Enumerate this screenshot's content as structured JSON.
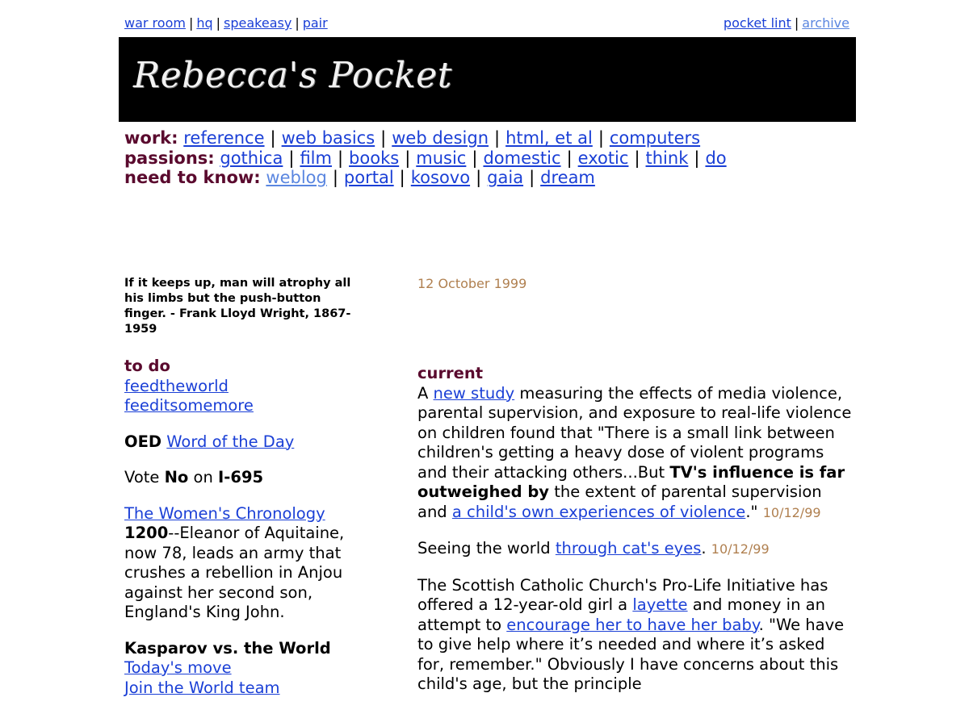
{
  "top_links": {
    "left": [
      "war room",
      "hq",
      "speakeasy",
      "pair"
    ],
    "right": [
      "pocket lint",
      "archive"
    ]
  },
  "banner": {
    "logo_text": "Rebecca's Pocket"
  },
  "nav": {
    "work": {
      "label": "work:",
      "links": [
        "reference",
        "web basics",
        "web design",
        "html, et al",
        "computers"
      ]
    },
    "passions": {
      "label": "passions:",
      "links": [
        "gothica",
        "film",
        "books",
        "music",
        "domestic",
        "exotic",
        "think",
        "do"
      ]
    },
    "need": {
      "label": "need to know:",
      "links": [
        "weblog",
        "portal",
        "kosovo",
        "gaia",
        "dream"
      ]
    }
  },
  "sidebar": {
    "quote": "If it keeps up, man will atrophy all his limbs but the push-button finger. - Frank Lloyd Wright, 1867-1959",
    "todo": {
      "title": "to do",
      "links": [
        "feedtheworld",
        "feeditsomemore"
      ]
    },
    "oed": {
      "bold": "OED",
      "link": "Word of the Day"
    },
    "vote": {
      "pre": "Vote",
      "no": "No",
      "on": "on",
      "measure": "I-695"
    },
    "chronology": {
      "link": "The Women's Chronology",
      "year": "1200",
      "text": "--Eleanor of Aquitaine, now 78, leads an army that crushes a rebellion in Anjou against her second son, England's King John."
    },
    "kasparov": {
      "title": "Kasparov vs. the World",
      "links": [
        "Today's move",
        "Join the World team"
      ]
    }
  },
  "main": {
    "date": "12 October 1999",
    "section_title": "current",
    "p1": {
      "a": "A",
      "link1": "new study",
      "b": "measuring the effects of media violence, parental supervision, and exposure to real-life violence on children found that \"There is a small link between children's getting a heavy dose of violent programs and their attacking others...But",
      "bold": "TV's influence is far outweighed by",
      "c": "the extent of parental supervision and",
      "link2": "a child's own experiences of violence",
      "d": ".\"",
      "stamp": "10/12/99"
    },
    "p2": {
      "a": "Seeing the world",
      "link": "through cat's eyes",
      "b": ".",
      "stamp": "10/12/99"
    },
    "p3": {
      "a": "The Scottish Catholic Church's Pro-Life Initiative has offered a 12-year-old girl a",
      "link1": "layette",
      "b": "and money in an attempt to",
      "link2": "encourage her to have her baby",
      "c": ". \"We have to give help where it’s needed and where it’s asked for, remember.\" Obviously I have concerns about this child's age, but the principle"
    }
  }
}
